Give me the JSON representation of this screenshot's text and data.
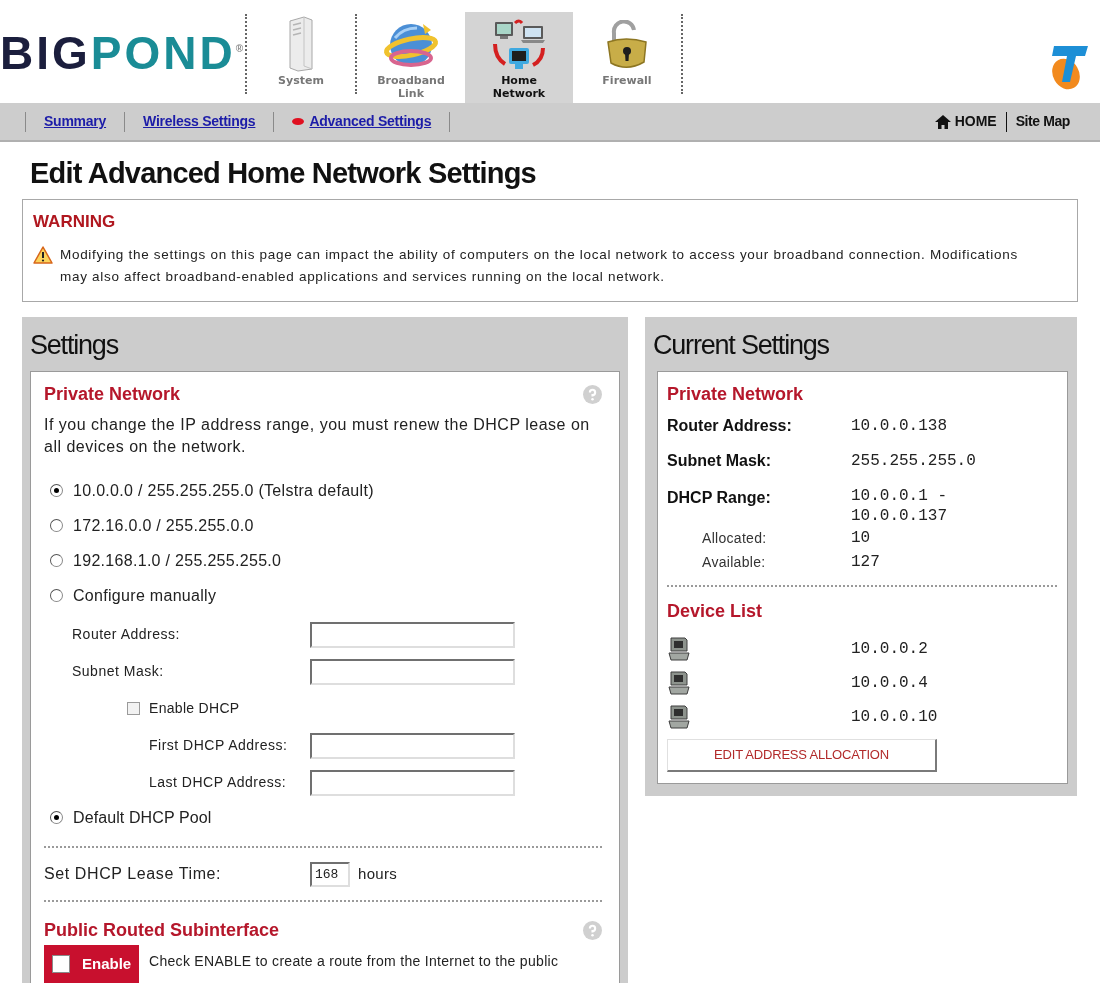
{
  "header": {
    "logo": {
      "words": [
        "BIG",
        "POND"
      ],
      "mark": "®"
    },
    "tabs": [
      {
        "label": "System",
        "selected": false
      },
      {
        "label": "Broadband Link",
        "selected": false
      },
      {
        "label": "Home Network",
        "selected": true
      },
      {
        "label": "Firewall",
        "selected": false
      }
    ]
  },
  "subnav": {
    "links": [
      {
        "label": "Summary",
        "selected": false
      },
      {
        "label": "Wireless Settings",
        "selected": false
      },
      {
        "label": "Advanced Settings",
        "selected": true
      }
    ],
    "home": "HOME",
    "site_map": "Site Map"
  },
  "page_title": "Edit Advanced Home Network Settings",
  "warning": {
    "title": "WARNING",
    "text": "Modifying the settings on this page can impact the ability of computers on the local network to access your broadband connection. Modifications may also affect broadband-enabled applications and services running on the local network."
  },
  "settings": {
    "title": "Settings",
    "private_network": {
      "heading": "Private Network",
      "note": "If you change the IP address range, you must renew the DHCP lease on all devices on the network.",
      "ranges": [
        {
          "label": "10.0.0.0 / 255.255.255.0 (Telstra default)",
          "selected": true
        },
        {
          "label": "172.16.0.0 / 255.255.0.0",
          "selected": false
        },
        {
          "label": "192.168.1.0 / 255.255.255.0",
          "selected": false
        },
        {
          "label": "Configure manually",
          "selected": false
        }
      ],
      "manual": [
        {
          "kind": "field",
          "label": "Router Address:"
        },
        {
          "kind": "field",
          "label": "Subnet Mask:"
        },
        {
          "kind": "checkbox",
          "label": "Enable DHCP",
          "checked": false
        },
        {
          "kind": "subfield",
          "label": "First DHCP Address:"
        },
        {
          "kind": "subfield",
          "label": "Last DHCP Address:"
        }
      ],
      "dhcp_pool": {
        "label": "Default DHCP Pool",
        "selected": true
      }
    },
    "lease_time": {
      "label": "Set DHCP Lease Time:",
      "value": "168",
      "unit": "hours"
    },
    "public_subinterface": {
      "heading": "Public Routed Subinterface",
      "enable": {
        "label": "Enable",
        "checked": false
      },
      "note": "Check ENABLE to create a route from the Internet to the public"
    }
  },
  "current_settings": {
    "title": "Current Settings",
    "private_network": {
      "heading": "Private Network",
      "rows": [
        {
          "kind": "main",
          "label": "Router Address:",
          "value": "10.0.0.138"
        },
        {
          "kind": "main",
          "label": "Subnet Mask:",
          "value": "255.255.255.0"
        },
        {
          "kind": "range",
          "label": "DHCP Range:",
          "value": "10.0.0.1 - 10.0.0.137"
        },
        {
          "kind": "sub",
          "label": "Allocated:",
          "value": "10"
        },
        {
          "kind": "sub",
          "label": "Available:",
          "value": "127"
        }
      ]
    },
    "device_list": {
      "heading": "Device List",
      "devices": [
        {
          "address": "10.0.0.2"
        },
        {
          "address": "10.0.0.4"
        },
        {
          "address": "10.0.0.10"
        }
      ]
    },
    "edit_button": "EDIT ADDRESS ALLOCATION"
  }
}
